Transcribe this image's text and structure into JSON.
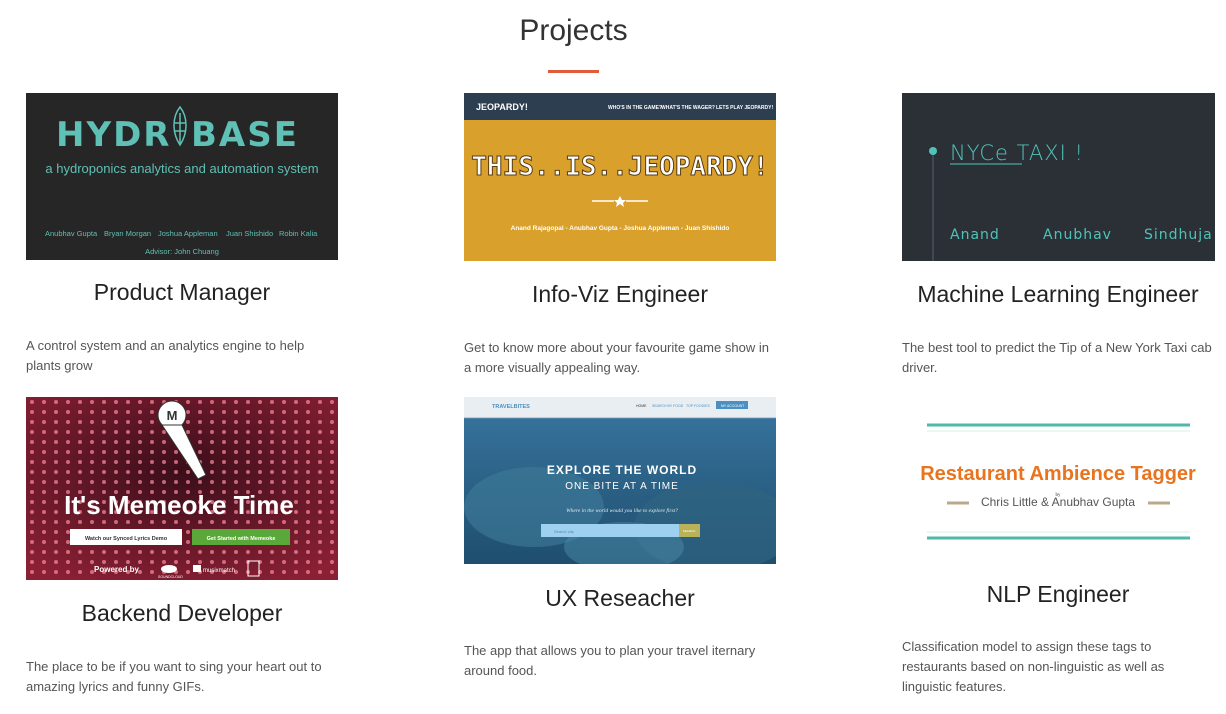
{
  "section": {
    "title": "Projects"
  },
  "projects": [
    {
      "role": "Product Manager",
      "description": "A control system and an analytics engine to help plants grow",
      "thumb": {
        "logo_left": "HYDR",
        "logo_right": "BASE",
        "tagline": "a hydroponics analytics and automation system",
        "names": [
          "Anubhav Gupta",
          "Bryan Morgan",
          "Joshua Appleman",
          "Juan Shishido",
          "Robin Kalia"
        ],
        "advisor": "Advisor: John Chuang"
      }
    },
    {
      "role": "Info-Viz Engineer",
      "description": "Get to know more about your favourite game show in a more visually appealing way.",
      "thumb": {
        "brand": "JEOPARDY!",
        "nav": [
          "WHO'S IN THE GAME?",
          "WHAT'S THE WAGER?",
          "LETS PLAY JEOPARDY!"
        ],
        "headline": "THIS..IS..JEOPARDY!",
        "credits": "Anand Rajagopal - Anubhav Gupta - Joshua Appleman - Juan Shishido"
      }
    },
    {
      "role": "Machine Learning Engineer",
      "description": "The best tool to predict the Tip of a New York Taxi cab driver.",
      "thumb": {
        "title": "NYCe TAXI !",
        "names": [
          "Anand",
          "Anubhav",
          "Sindhuja"
        ]
      }
    },
    {
      "role": "Backend Developer",
      "description": "The place to be if you want to sing your heart out to amazing lyrics and funny GIFs.",
      "thumb": {
        "headline": "It's Memeoke Time",
        "btn_demo": "Watch our Synced Lyrics Demo",
        "btn_start": "Get Started with Memeoke",
        "powered": "Powered by",
        "partners": [
          "SOUNDCLOUD",
          "musixmatch"
        ]
      }
    },
    {
      "role": "UX Reseacher",
      "description": "The app that allows you to plan your travel iternary around food.",
      "thumb": {
        "brand": "TRAVELBITES",
        "nav": [
          "HOME",
          "SEARCH BY FOOD",
          "TOP FOODIES",
          "MY ACCOUNT"
        ],
        "headline": "EXPLORE THE WORLD",
        "subhead": "ONE BITE AT A TIME",
        "prompt": "Where in the world would you like to explore first?",
        "search_placeholder": "Search city",
        "search_btn": "SEARCH"
      }
    },
    {
      "role": "NLP Engineer",
      "description": "Classification model to assign these tags to restaurants based on non-linguistic as well as linguistic features.",
      "thumb": {
        "title": "Restaurant Ambience Tagger",
        "by": "by",
        "authors": "Chris Little & Anubhav Gupta"
      }
    }
  ],
  "colors": {
    "accent": "#e05b3a",
    "hydrobase_teal": "#5fc0b6",
    "jeopardy_gold": "#d9a02b",
    "jeopardy_nav": "#2c3e50",
    "taxi_teal": "#4fc3b8",
    "memeoke_red": "#7a1b2e",
    "travel_blue": "#2a6f9c",
    "nlp_orange": "#e8741f"
  }
}
